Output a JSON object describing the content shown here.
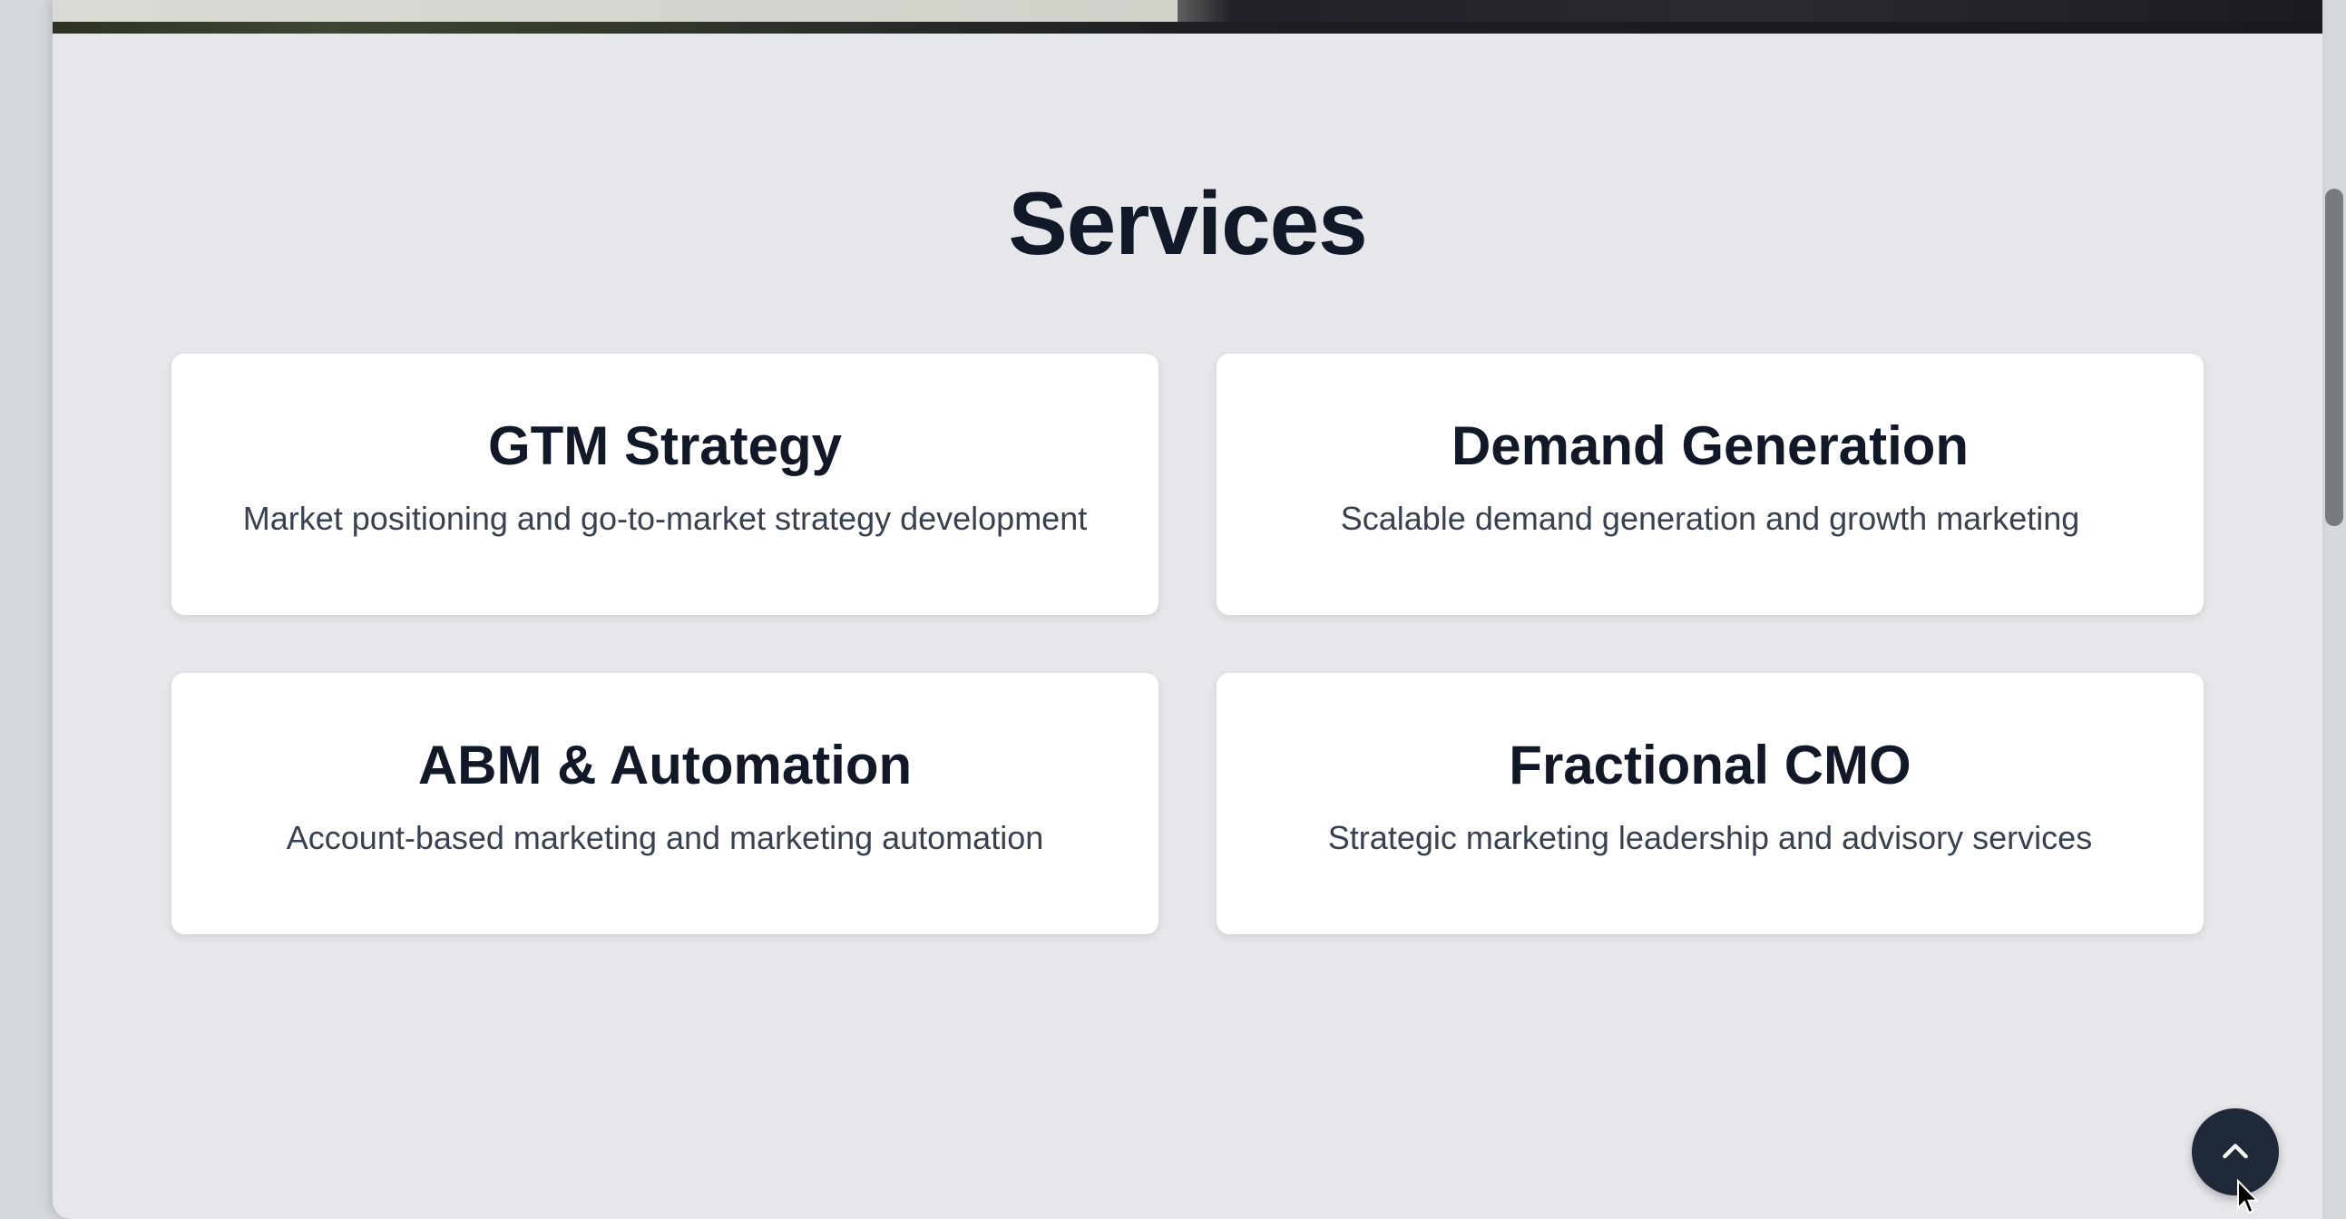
{
  "services": {
    "title": "Services",
    "cards": [
      {
        "title": "GTM Strategy",
        "description": "Market positioning and go-to-market strategy development"
      },
      {
        "title": "Demand Generation",
        "description": "Scalable demand generation and growth marketing"
      },
      {
        "title": "ABM & Automation",
        "description": "Account-based marketing and marketing automation"
      },
      {
        "title": "Fractional CMO",
        "description": "Strategic marketing leadership and advisory services"
      }
    ]
  },
  "back_to_top": {
    "icon": "chevron-up-icon"
  },
  "colors": {
    "page_bg": "#e5e7eb",
    "card_bg": "#ffffff",
    "heading": "#111827",
    "body_text": "#374151",
    "button_bg": "#1f2937"
  }
}
